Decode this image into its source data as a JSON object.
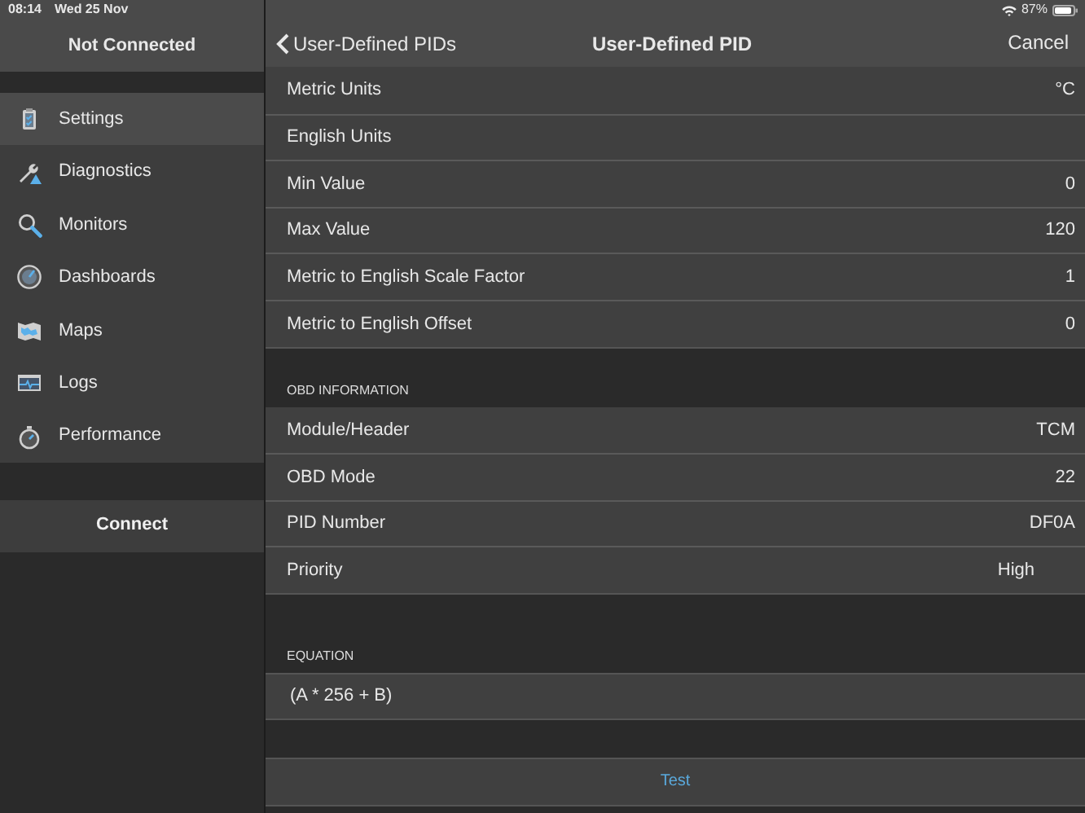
{
  "status_bar": {
    "time": "08:14",
    "date": "Wed 25 Nov",
    "battery": "87%"
  },
  "sidebar": {
    "title": "Not Connected",
    "items": [
      {
        "label": "Settings",
        "selected": true
      },
      {
        "label": "Diagnostics",
        "selected": false
      },
      {
        "label": "Monitors",
        "selected": false
      },
      {
        "label": "Dashboards",
        "selected": false
      },
      {
        "label": "Maps",
        "selected": false
      },
      {
        "label": "Logs",
        "selected": false
      },
      {
        "label": "Performance",
        "selected": false
      }
    ],
    "connect": "Connect"
  },
  "nav": {
    "back": "User-Defined PIDs",
    "title": "User-Defined PID",
    "cancel": "Cancel"
  },
  "sections": [
    {
      "rows": [
        {
          "label": "Metric Units",
          "value": "°C"
        },
        {
          "label": "English Units"
        },
        {
          "label": "Min Value",
          "value": "0"
        },
        {
          "label": "Max Value",
          "value": "120"
        },
        {
          "label": "Metric to English Scale Factor",
          "value": "1"
        },
        {
          "label": "Metric to English Offset",
          "value": "0"
        }
      ]
    },
    {
      "header": "OBD INFORMATION",
      "rows": [
        {
          "label": "Module/Header",
          "value": "TCM"
        },
        {
          "label": "OBD Mode",
          "value": "22"
        },
        {
          "label": "PID Number",
          "value": "DF0A"
        },
        {
          "label": "Priority",
          "value": "High",
          "kind": "picker"
        }
      ]
    }
  ],
  "equation": {
    "header": "EQUATION",
    "value": "(A * 256 + B)"
  },
  "test_button": "Test"
}
